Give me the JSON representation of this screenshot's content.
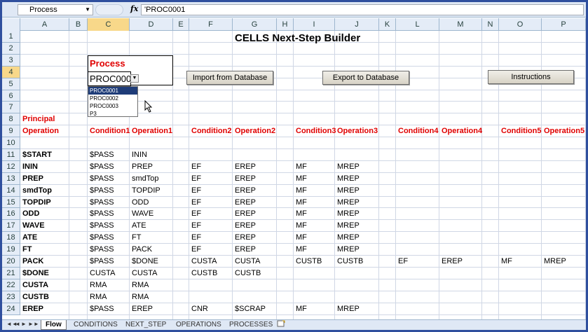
{
  "formula_bar": {
    "name_box": "Process",
    "fx": "fx",
    "formula": "'PROC0001"
  },
  "columns": [
    "A",
    "B",
    "C",
    "D",
    "E",
    "F",
    "G",
    "H",
    "I",
    "J",
    "K",
    "L",
    "M",
    "N",
    "O",
    "P"
  ],
  "rows": [
    "1",
    "2",
    "3",
    "4",
    "5",
    "6",
    "7",
    "8",
    "9",
    "10",
    "11",
    "12",
    "13",
    "14",
    "15",
    "16",
    "17",
    "18",
    "19",
    "20",
    "21",
    "22",
    "23",
    "24"
  ],
  "title": "CELLS Next-Step Builder",
  "process": {
    "label": "Process",
    "value": "PROC0001",
    "options": [
      "PROC0001",
      "PROC0002",
      "PROC0003",
      "P3"
    ]
  },
  "buttons": {
    "import": "Import from Database",
    "export": "Export to Database",
    "instructions": "Instructions"
  },
  "headers": {
    "principal_line1": "Principal",
    "principal_line2": "Operation",
    "condition1": "Condition1",
    "operation1": "Operation1",
    "condition2": "Condition2",
    "operation2": "Operation2",
    "condition3": "Condition3",
    "operation3": "Operation3",
    "condition4": "Condition4",
    "operation4": "Operation4",
    "condition5": "Condition5",
    "operation5": "Operation5"
  },
  "table_rows": [
    {
      "a": "$START",
      "c": "$PASS",
      "d": "ININ",
      "f": "",
      "g": "",
      "i": "",
      "j": "",
      "l": "",
      "m": "",
      "o": "",
      "p": ""
    },
    {
      "a": "ININ",
      "c": "$PASS",
      "d": "PREP",
      "f": "EF",
      "g": "EREP",
      "i": "MF",
      "j": "MREP",
      "l": "",
      "m": "",
      "o": "",
      "p": ""
    },
    {
      "a": "PREP",
      "c": "$PASS",
      "d": "smdTop",
      "f": "EF",
      "g": "EREP",
      "i": "MF",
      "j": "MREP",
      "l": "",
      "m": "",
      "o": "",
      "p": ""
    },
    {
      "a": "smdTop",
      "c": "$PASS",
      "d": "TOPDIP",
      "f": "EF",
      "g": "EREP",
      "i": "MF",
      "j": "MREP",
      "l": "",
      "m": "",
      "o": "",
      "p": ""
    },
    {
      "a": "TOPDIP",
      "c": "$PASS",
      "d": "ODD",
      "f": "EF",
      "g": "EREP",
      "i": "MF",
      "j": "MREP",
      "l": "",
      "m": "",
      "o": "",
      "p": ""
    },
    {
      "a": "ODD",
      "c": "$PASS",
      "d": "WAVE",
      "f": "EF",
      "g": "EREP",
      "i": "MF",
      "j": "MREP",
      "l": "",
      "m": "",
      "o": "",
      "p": ""
    },
    {
      "a": "WAVE",
      "c": "$PASS",
      "d": "ATE",
      "f": "EF",
      "g": "EREP",
      "i": "MF",
      "j": "MREP",
      "l": "",
      "m": "",
      "o": "",
      "p": ""
    },
    {
      "a": "ATE",
      "c": "$PASS",
      "d": "FT",
      "f": "EF",
      "g": "EREP",
      "i": "MF",
      "j": "MREP",
      "l": "",
      "m": "",
      "o": "",
      "p": ""
    },
    {
      "a": "FT",
      "c": "$PASS",
      "d": "PACK",
      "f": "EF",
      "g": "EREP",
      "i": "MF",
      "j": "MREP",
      "l": "",
      "m": "",
      "o": "",
      "p": ""
    },
    {
      "a": "PACK",
      "c": "$PASS",
      "d": "$DONE",
      "f": "CUSTA",
      "g": "CUSTA",
      "i": "CUSTB",
      "j": "CUSTB",
      "l": "EF",
      "m": "EREP",
      "o": "MF",
      "p": "MREP"
    },
    {
      "a": "$DONE",
      "c": "CUSTA",
      "d": "CUSTA",
      "f": "CUSTB",
      "g": "CUSTB",
      "i": "",
      "j": "",
      "l": "",
      "m": "",
      "o": "",
      "p": ""
    },
    {
      "a": "CUSTA",
      "c": "RMA",
      "d": "RMA",
      "f": "",
      "g": "",
      "i": "",
      "j": "",
      "l": "",
      "m": "",
      "o": "",
      "p": ""
    },
    {
      "a": "CUSTB",
      "c": "RMA",
      "d": "RMA",
      "f": "",
      "g": "",
      "i": "",
      "j": "",
      "l": "",
      "m": "",
      "o": "",
      "p": ""
    },
    {
      "a": "EREP",
      "c": "$PASS",
      "d": "EREP",
      "f": "CNR",
      "g": "$SCRAP",
      "i": "MF",
      "j": "MREP",
      "l": "",
      "m": "",
      "o": "",
      "p": ""
    }
  ],
  "tabs": [
    "Flow",
    "CONDITIONS",
    "NEXT_STEP",
    "OPERATIONS",
    "PROCESSES"
  ],
  "tab_nav": [
    "◄◄",
    "◄",
    "►",
    "►►"
  ]
}
